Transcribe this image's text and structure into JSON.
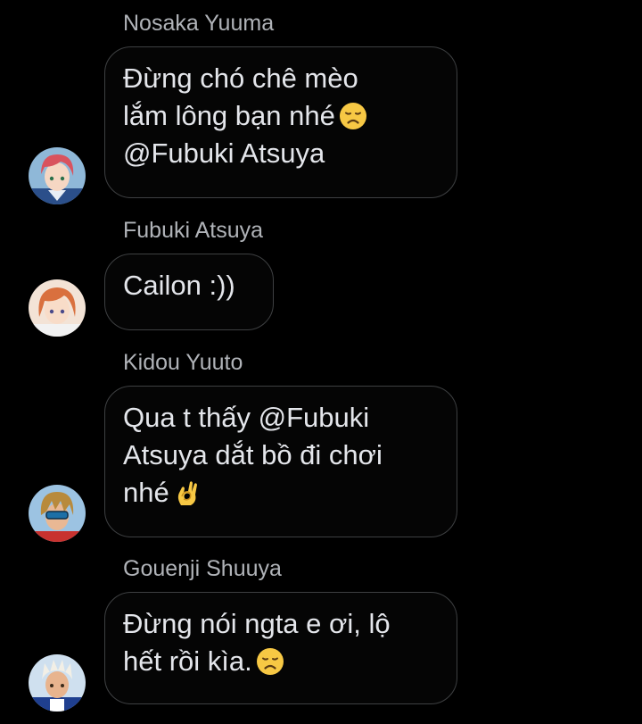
{
  "messages": [
    {
      "sender": "Nosaka Yuuma",
      "lines": [
        "Đừng chó chê mèo",
        "lắm lông bạn nhé",
        "@Fubuki Atsuya"
      ],
      "avatar_icon": "anime-pink-hair-avatar-icon"
    },
    {
      "sender": "Fubuki Atsuya",
      "lines": [
        "Cailon :))"
      ],
      "avatar_icon": "anime-orange-hair-avatar-icon"
    },
    {
      "sender": "Kidou Yuuto",
      "lines": [
        "Qua t thấy @Fubuki",
        "Atsuya dắt bồ đi chơi",
        "nhé"
      ],
      "avatar_icon": "anime-goggles-dreadlocks-avatar-icon"
    },
    {
      "sender": "Gouenji Shuuya",
      "lines": [
        "Đừng nói ngta e ơi, lộ",
        "hết rồi kìa."
      ],
      "avatar_icon": "anime-white-hair-avatar-icon"
    }
  ],
  "emoji": {
    "sad": "disappointed-face-emoji",
    "ok": "ok-hand-emoji"
  },
  "colors": {
    "background": "#000000",
    "bubble_border": "#3e4042",
    "message_text": "#e4e6eb",
    "sender_text": "#b0b3b8",
    "emoji_yellow": "#f7c844"
  }
}
